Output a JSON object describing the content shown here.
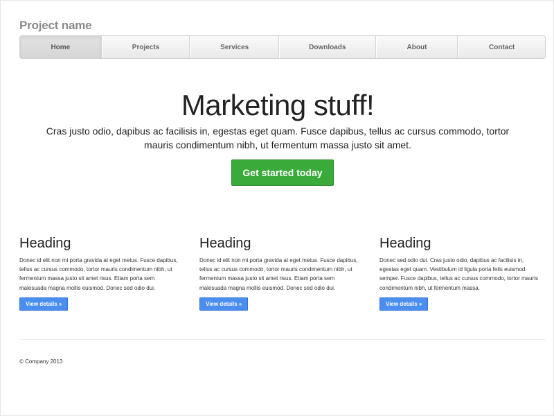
{
  "brand": {
    "name": "Project name"
  },
  "nav": {
    "items": [
      {
        "label": "Home",
        "active": true
      },
      {
        "label": "Projects",
        "active": false
      },
      {
        "label": "Services",
        "active": false
      },
      {
        "label": "Downloads",
        "active": false
      },
      {
        "label": "About",
        "active": false
      },
      {
        "label": "Contact",
        "active": false
      }
    ]
  },
  "jumbotron": {
    "title": "Marketing stuff!",
    "lead": "Cras justo odio, dapibus ac facilisis in, egestas eget quam. Fusce dapibus, tellus ac cursus commodo, tortor mauris condimentum nibh, ut fermentum massa justo sit amet.",
    "cta_label": "Get started today"
  },
  "columns": [
    {
      "heading": "Heading",
      "body": "Donec id elit non mi porta gravida at eget metus. Fusce dapibus, tellus ac cursus commodo, tortor mauris condimentum nibh, ut fermentum massa justo sit amet risus. Etiam porta sem malesuada magna mollis euismod. Donec sed odio dui.",
      "button_label": "View details »"
    },
    {
      "heading": "Heading",
      "body": "Donec id elit non mi porta gravida at eget metus. Fusce dapibus, tellus ac cursus commodo, tortor mauris condimentum nibh, ut fermentum massa justo sit amet risus. Etiam porta sem malesuada magna mollis euismod. Donec sed odio dui.",
      "button_label": "View details »"
    },
    {
      "heading": "Heading",
      "body": "Donec sed odio dui. Cras justo odio, dapibus ac facilisis in, egestas eget quam. Vestibulum id ligula porta felis euismod semper. Fusce dapibus, tellus ac cursus commodo, tortor mauris condimentum nibh, ut fermentum massa.",
      "button_label": "View details »"
    }
  ],
  "footer": {
    "text": "© Company 2013"
  },
  "colors": {
    "success": "#3aaa3a",
    "primary": "#4a8ef0",
    "brand_text": "#8a8a8a"
  }
}
